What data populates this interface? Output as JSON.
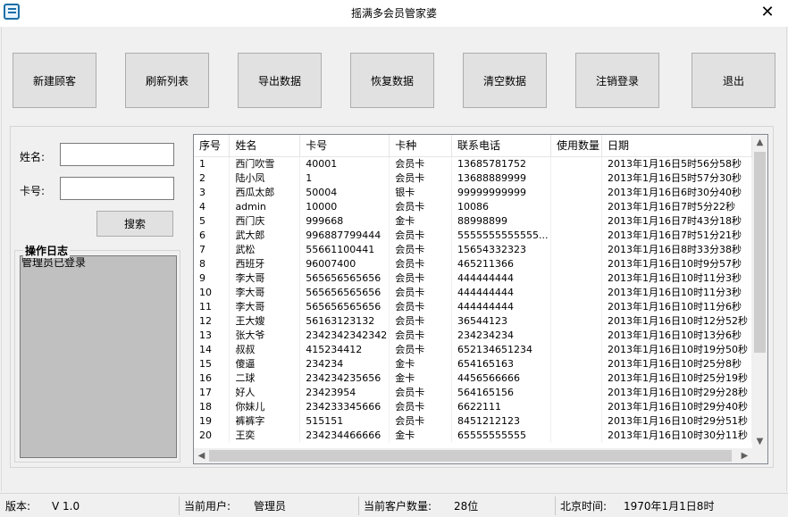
{
  "window": {
    "title": "摇满多会员管家婆",
    "close_glyph": "✕"
  },
  "toolbar": {
    "buttons": [
      "新建顾客",
      "刷新列表",
      "导出数据",
      "恢复数据",
      "清空数据",
      "注销登录",
      "退出"
    ]
  },
  "search": {
    "name_label": "姓名:",
    "card_label": "卡号:",
    "name_value": "",
    "card_value": "",
    "button_label": "搜索"
  },
  "log": {
    "group_title": "操作日志",
    "text": "管理员已登录"
  },
  "table": {
    "columns": [
      "序号",
      "姓名",
      "卡号",
      "卡种",
      "联系电话",
      "使用数量",
      "日期"
    ],
    "rows": [
      [
        "1",
        "西门吹雪",
        "40001",
        "会员卡",
        "13685781752",
        "",
        "2013年1月16日5时56分58秒"
      ],
      [
        "2",
        "陆小凤",
        "1",
        "会员卡",
        "13688889999",
        "",
        "2013年1月16日5时57分30秒"
      ],
      [
        "3",
        "西瓜太郎",
        "50004",
        "银卡",
        "99999999999",
        "",
        "2013年1月16日6时30分40秒"
      ],
      [
        "4",
        "admin",
        "10000",
        "会员卡",
        "10086",
        "",
        "2013年1月16日7时5分22秒"
      ],
      [
        "5",
        "西门庆",
        "999668",
        "金卡",
        "88998899",
        "",
        "2013年1月16日7时43分18秒"
      ],
      [
        "6",
        "武大郎",
        "996887799444",
        "会员卡",
        "5555555555555...",
        "",
        "2013年1月16日7时51分21秒"
      ],
      [
        "7",
        "武松",
        "55661100441",
        "会员卡",
        "15654332323",
        "",
        "2013年1月16日8时33分38秒"
      ],
      [
        "8",
        "西班牙",
        "96007400",
        "会员卡",
        "465211366",
        "",
        "2013年1月16日10时9分57秒"
      ],
      [
        "9",
        "李大哥",
        "565656565656",
        "会员卡",
        "444444444",
        "",
        "2013年1月16日10时11分3秒"
      ],
      [
        "10",
        "李大哥",
        "565656565656",
        "会员卡",
        "444444444",
        "",
        "2013年1月16日10时11分3秒"
      ],
      [
        "11",
        "李大哥",
        "565656565656",
        "会员卡",
        "444444444",
        "",
        "2013年1月16日10时11分6秒"
      ],
      [
        "12",
        "王大嫂",
        "56163123132",
        "会员卡",
        "36544123",
        "",
        "2013年1月16日10时12分52秒"
      ],
      [
        "13",
        "张大爷",
        "2342342342342",
        "会员卡",
        "234234234",
        "",
        "2013年1月16日10时13分6秒"
      ],
      [
        "14",
        "叔叔",
        "415234412",
        "会员卡",
        "652134651234",
        "",
        "2013年1月16日10时19分50秒"
      ],
      [
        "15",
        "傻逼",
        "234234",
        "金卡",
        "654165163",
        "",
        "2013年1月16日10时25分8秒"
      ],
      [
        "16",
        "二球",
        "234234235656",
        "金卡",
        "4456566666",
        "",
        "2013年1月16日10时25分19秒"
      ],
      [
        "17",
        "好人",
        "23423954",
        "会员卡",
        "564165156",
        "",
        "2013年1月16日10时29分28秒"
      ],
      [
        "18",
        "你妹儿",
        "234233345666",
        "会员卡",
        "6622111",
        "",
        "2013年1月16日10时29分40秒"
      ],
      [
        "19",
        "裤裤字",
        "515151",
        "会员卡",
        "8451212123",
        "",
        "2013年1月16日10时29分51秒"
      ],
      [
        "20",
        "王奕",
        "234234466666",
        "金卡",
        "65555555555",
        "",
        "2013年1月16日10时30分11秒"
      ]
    ]
  },
  "status": {
    "version_label": "版本:",
    "version_value": "V 1.0",
    "user_label": "当前用户:",
    "user_value": "管理员",
    "count_label": "当前客户数量:",
    "count_value": "28位",
    "time_label": "北京时间:",
    "time_value": "1970年1月1日8时"
  }
}
